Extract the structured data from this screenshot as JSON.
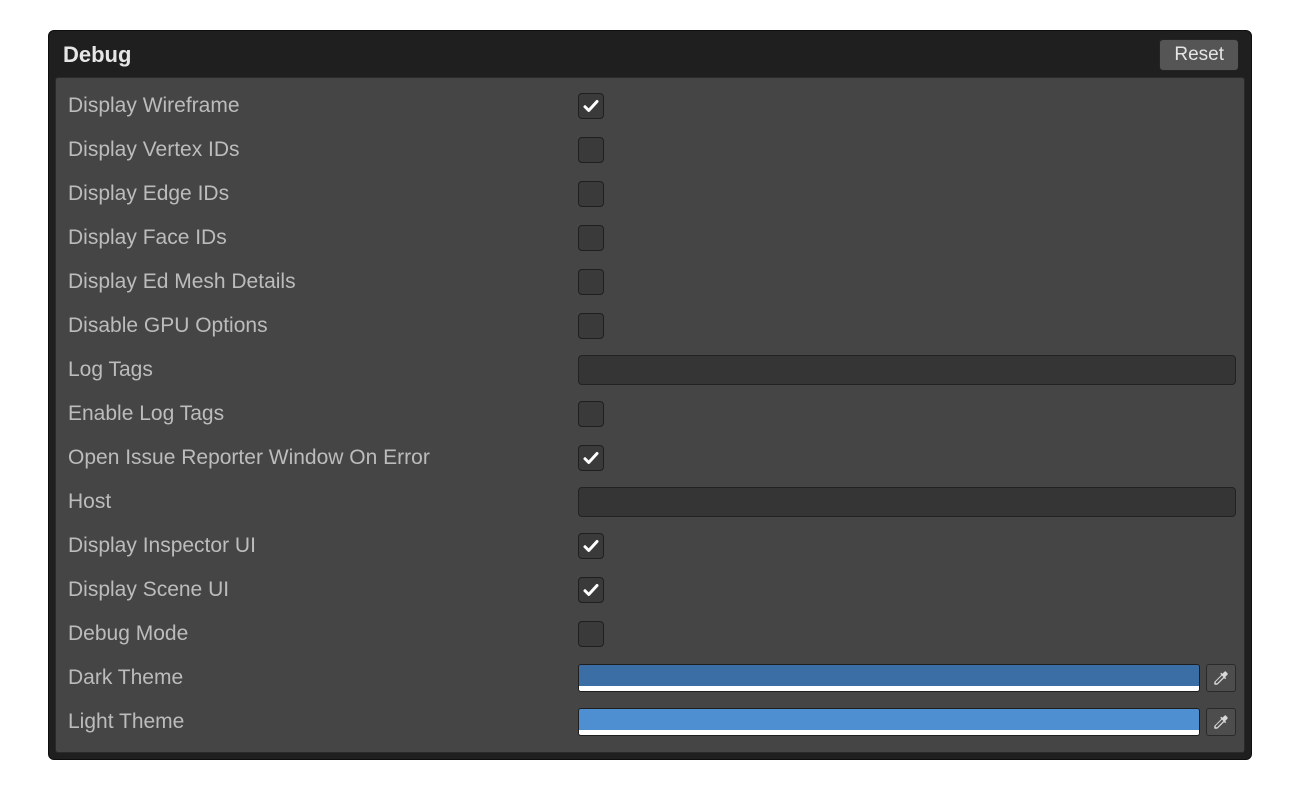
{
  "panel": {
    "title": "Debug",
    "reset_label": "Reset"
  },
  "rows": [
    {
      "key": "display-wireframe",
      "label": "Display Wireframe",
      "type": "checkbox",
      "checked": true
    },
    {
      "key": "display-vertex-ids",
      "label": "Display Vertex IDs",
      "type": "checkbox",
      "checked": false
    },
    {
      "key": "display-edge-ids",
      "label": "Display Edge IDs",
      "type": "checkbox",
      "checked": false
    },
    {
      "key": "display-face-ids",
      "label": "Display Face IDs",
      "type": "checkbox",
      "checked": false
    },
    {
      "key": "display-ed-mesh-details",
      "label": "Display Ed Mesh Details",
      "type": "checkbox",
      "checked": false
    },
    {
      "key": "disable-gpu-options",
      "label": "Disable GPU Options",
      "type": "checkbox",
      "checked": false
    },
    {
      "key": "log-tags",
      "label": "Log Tags",
      "type": "text",
      "value": ""
    },
    {
      "key": "enable-log-tags",
      "label": "Enable Log Tags",
      "type": "checkbox",
      "checked": false
    },
    {
      "key": "open-issue-reporter",
      "label": "Open Issue Reporter Window On Error",
      "type": "checkbox",
      "checked": true
    },
    {
      "key": "host",
      "label": "Host",
      "type": "text",
      "value": ""
    },
    {
      "key": "display-inspector-ui",
      "label": "Display Inspector UI",
      "type": "checkbox",
      "checked": true
    },
    {
      "key": "display-scene-ui",
      "label": "Display Scene UI",
      "type": "checkbox",
      "checked": true
    },
    {
      "key": "debug-mode",
      "label": "Debug Mode",
      "type": "checkbox",
      "checked": false
    },
    {
      "key": "dark-theme",
      "label": "Dark Theme",
      "type": "color",
      "value": "#3a6ea5"
    },
    {
      "key": "light-theme",
      "label": "Light Theme",
      "type": "color",
      "value": "#4d8fd1"
    }
  ]
}
